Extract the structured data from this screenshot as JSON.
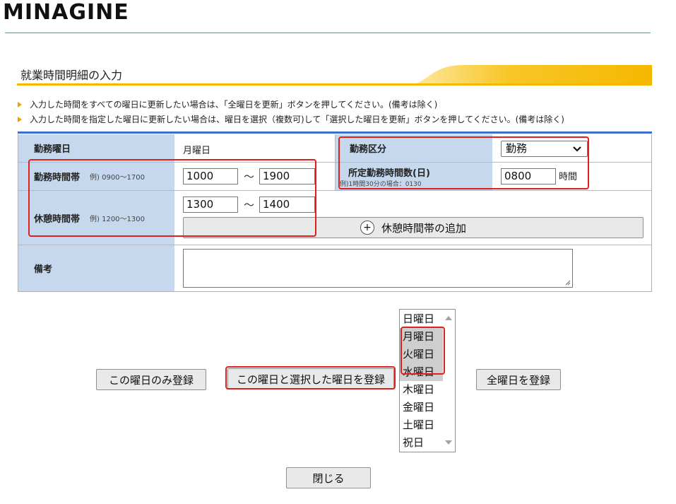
{
  "brand": {
    "logo_text": "MINAGINE"
  },
  "section": {
    "title": "就業時間明細の入力"
  },
  "notes": [
    "入力した時間をすべての曜日に更新したい場合は、「全曜日を更新」ボタンを押してください。(備考は除く)",
    "入力した時間を指定した曜日に更新したい場合は、曜日を選択（複数可)して「選択した曜日を更新」ボタンを押してください。(備考は除く)"
  ],
  "form": {
    "workday_label": "勤務曜日",
    "workday_value": "月曜日",
    "work_type_label": "勤務区分",
    "work_type_value": "勤務",
    "work_hours_label": "勤務時間帯",
    "work_hours_example": "例) 0900～1700",
    "work_start": "1000",
    "work_end": "1900",
    "range_sep": "～",
    "scheduled_hours_label": "所定勤務時間数(日)",
    "scheduled_hours_example": "例)1時間30分の場合：0130",
    "scheduled_hours_value": "0800",
    "scheduled_hours_unit": "時間",
    "break_label": "休憩時間帯",
    "break_example": "例) 1200～1300",
    "break_start": "1300",
    "break_end": "1400",
    "add_break_label": "休憩時間帯の追加",
    "add_break_icon": "plus-circle-icon",
    "remarks_label": "備考",
    "remarks_value": ""
  },
  "actions": {
    "register_this_day": "この曜日のみ登録",
    "register_selected": "この曜日と選択した曜日を登録",
    "register_all": "全曜日を登録",
    "close": "閉じる"
  },
  "days_list": {
    "options": [
      "日曜日",
      "月曜日",
      "火曜日",
      "水曜日",
      "木曜日",
      "金曜日",
      "土曜日",
      "祝日"
    ],
    "selected": [
      "月曜日",
      "火曜日",
      "水曜日"
    ]
  },
  "colors": {
    "header_bg": "#c5d8ee",
    "accent_blue": "#3a6fcf",
    "title_gradient": "#f5b800",
    "highlight_red": "#e02020"
  }
}
